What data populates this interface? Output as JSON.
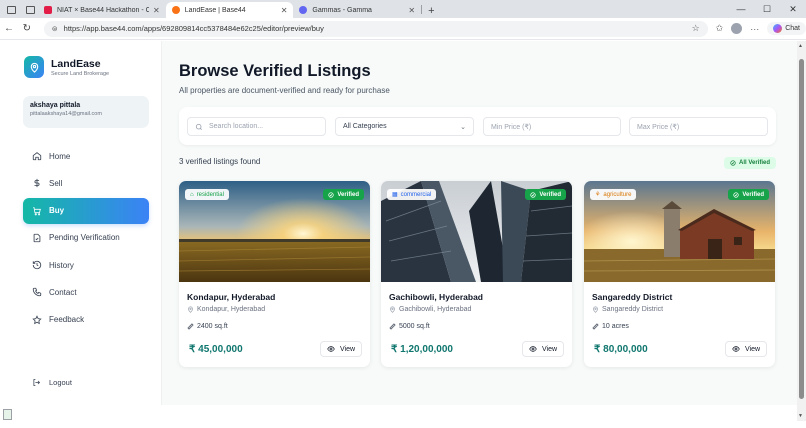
{
  "browser": {
    "tabs": [
      {
        "label": "NIAT × Base44 Hackathon - C",
        "color": "#e11d48",
        "active": false
      },
      {
        "label": "LandEase | Base44",
        "color": "#f97316",
        "active": true
      },
      {
        "label": "Gammas - Gamma",
        "color": "#6366f1",
        "active": false
      }
    ],
    "url": "https://app.base44.com/apps/692809814cc5378484e62c25/editor/preview/buy",
    "chat_label": "Chat"
  },
  "sidebar": {
    "brand_name": "LandEase",
    "brand_tagline": "Secure Land Brokerage",
    "user_name": "akshaya pittala",
    "user_email": "pittalaakshaya14@gmail.com",
    "nav": [
      {
        "label": "Home",
        "icon": "home-icon"
      },
      {
        "label": "Sell",
        "icon": "dollar-icon"
      },
      {
        "label": "Buy",
        "icon": "cart-icon",
        "active": true
      },
      {
        "label": "Pending Verification",
        "icon": "file-check-icon"
      },
      {
        "label": "History",
        "icon": "history-icon"
      },
      {
        "label": "Contact",
        "icon": "phone-icon"
      },
      {
        "label": "Feedback",
        "icon": "star-icon"
      }
    ],
    "logout_label": "Logout"
  },
  "main": {
    "title": "Browse Verified Listings",
    "subtitle": "All properties are document-verified and ready for purchase",
    "filters": {
      "search_placeholder": "Search location...",
      "category_value": "All Categories",
      "min_price_placeholder": "Min Price (₹)",
      "max_price_placeholder": "Max Price (₹)"
    },
    "count_text": "3 verified listings found",
    "all_verified_label": "All Verified"
  },
  "listings": [
    {
      "type": "residential",
      "type_color": "#16a34a",
      "verified_label": "Verified",
      "title": "Kondapur, Hyderabad",
      "location": "Kondapur, Hyderabad",
      "area": "2400 sq.ft",
      "price": "₹ 45,00,000",
      "view_label": "View",
      "image": "sunset-field"
    },
    {
      "type": "commercial",
      "type_color": "#2563eb",
      "verified_label": "Verified",
      "title": "Gachibowli, Hyderabad",
      "location": "Gachibowli, Hyderabad",
      "area": "5000 sq.ft",
      "price": "₹ 1,20,00,000",
      "view_label": "View",
      "image": "skyscrapers"
    },
    {
      "type": "agriculture",
      "type_color": "#d97706",
      "verified_label": "Verified",
      "title": "Sangareddy District",
      "location": "Sangareddy District",
      "area": "10 acres",
      "price": "₹ 80,00,000",
      "view_label": "View",
      "image": "barn-sunset"
    }
  ]
}
